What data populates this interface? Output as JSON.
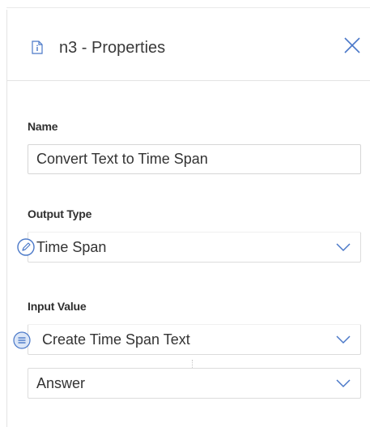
{
  "header": {
    "title": "n3 - Properties",
    "icon": "document-info-icon",
    "close_icon": "close-icon"
  },
  "name_field": {
    "label": "Name",
    "value": "Convert Text to Time Span"
  },
  "output_type": {
    "label": "Output Type",
    "selected": "Time Span",
    "badge_icon": "pencil-icon"
  },
  "input_value": {
    "label": "Input Value",
    "selected": "Create Time Span Text",
    "badge_icon": "list-icon",
    "sub_selected": "Answer"
  },
  "colors": {
    "accent": "#4a78c8",
    "border": "#d6d6d6",
    "text": "#333333"
  }
}
